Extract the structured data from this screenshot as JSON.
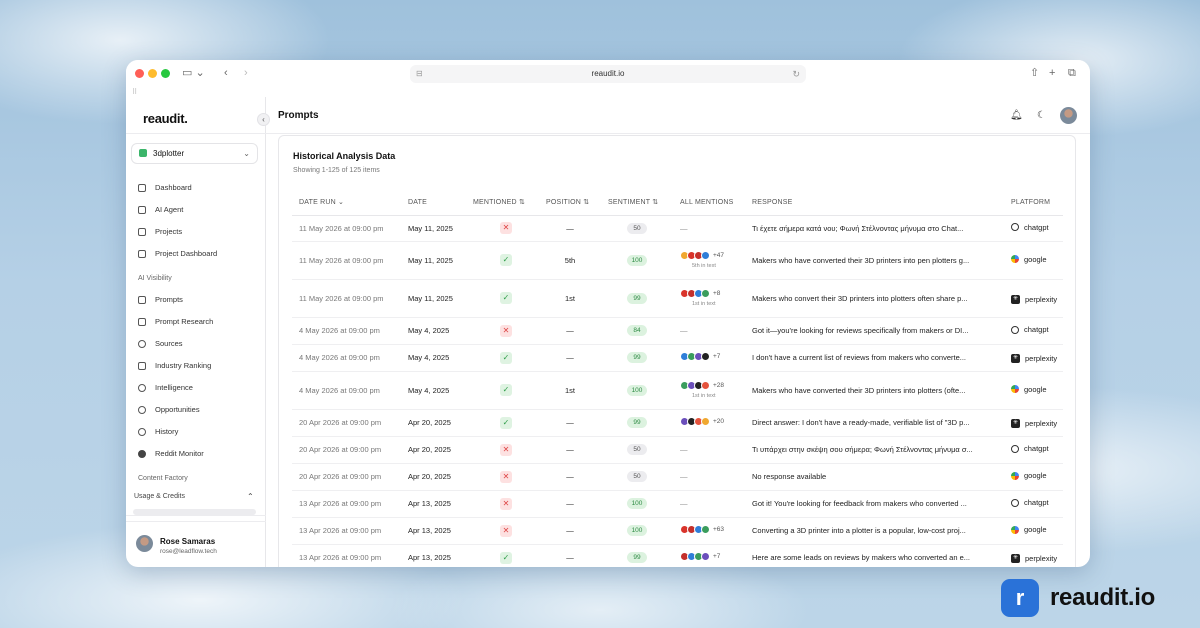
{
  "browser": {
    "url": "reaudit.io"
  },
  "sidebar": {
    "logo": "reaudit.",
    "project": "3dplotter",
    "items": [
      {
        "label": "Dashboard",
        "icon": "home-icon"
      },
      {
        "label": "AI Agent",
        "icon": "robot-icon"
      },
      {
        "label": "Projects",
        "icon": "folder-icon"
      },
      {
        "label": "Project Dashboard",
        "icon": "bar-chart-icon"
      }
    ],
    "section_ai": "AI Visibility",
    "ai_items": [
      {
        "label": "Prompts",
        "icon": "chat-icon"
      },
      {
        "label": "Prompt Research",
        "icon": "wand-icon"
      },
      {
        "label": "Sources",
        "icon": "link-icon"
      },
      {
        "label": "Industry Ranking",
        "icon": "trending-icon"
      },
      {
        "label": "Intelligence",
        "icon": "target-icon"
      },
      {
        "label": "Opportunities",
        "icon": "lightbulb-icon"
      },
      {
        "label": "History",
        "icon": "clock-icon"
      },
      {
        "label": "Reddit Monitor",
        "icon": "reddit-icon"
      }
    ],
    "section_content": "Content Factory",
    "usage_label": "Usage & Credits",
    "user": {
      "name": "Rose Samaras",
      "email": "rose@leadflow.tech"
    }
  },
  "header": {
    "title": "Prompts"
  },
  "card": {
    "title": "Historical Analysis Data",
    "subtitle": "Showing 1-125 of 125 items"
  },
  "table": {
    "headers": [
      "DATE RUN ⌄",
      "DATE",
      "MENTIONED ⇅",
      "POSITION ⇅",
      "SENTIMENT ⇅",
      "ALL MENTIONS",
      "RESPONSE",
      "PLATFORM"
    ],
    "rows": [
      {
        "run": "11 May 2026 at 09:00 pm",
        "date": "May 11, 2025",
        "mentioned": false,
        "position": "—",
        "sentiment": "50",
        "mentions": null,
        "mentions_sub": "",
        "response": "Τι έχετε σήμερα κατά νου; Φωνή Στέλνοντας μήνυμα στο Chat...",
        "platform": "chatgpt"
      },
      {
        "run": "11 May 2026 at 09:00 pm",
        "date": "May 11, 2025",
        "mentioned": true,
        "position": "5th",
        "sentiment": "100",
        "mentions": "+47",
        "mentions_sub": "5th in text",
        "response": "Makers who have converted their 3D printers into pen plotters g...",
        "platform": "google"
      },
      {
        "run": "11 May 2026 at 09:00 pm",
        "date": "May 11, 2025",
        "mentioned": true,
        "position": "1st",
        "sentiment": "99",
        "mentions": "+8",
        "mentions_sub": "1st in text",
        "response": "Makers who convert their 3D printers into plotters often share p...",
        "platform": "perplexity"
      },
      {
        "run": "4 May 2026 at 09:00 pm",
        "date": "May 4, 2025",
        "mentioned": false,
        "position": "—",
        "sentiment": "84",
        "mentions": null,
        "mentions_sub": "",
        "response": "Got it—you're looking for reviews specifically from makers or DI...",
        "platform": "chatgpt"
      },
      {
        "run": "4 May 2026 at 09:00 pm",
        "date": "May 4, 2025",
        "mentioned": true,
        "position": "—",
        "sentiment": "99",
        "mentions": "+7",
        "mentions_sub": "",
        "response": "I don't have a current list of reviews from makers who converte...",
        "platform": "perplexity"
      },
      {
        "run": "4 May 2026 at 09:00 pm",
        "date": "May 4, 2025",
        "mentioned": true,
        "position": "1st",
        "sentiment": "100",
        "mentions": "+28",
        "mentions_sub": "1st in text",
        "response": "Makers who have converted their 3D printers into plotters (ofte...",
        "platform": "google"
      },
      {
        "run": "20 Apr 2026 at 09:00 pm",
        "date": "Apr 20, 2025",
        "mentioned": true,
        "position": "—",
        "sentiment": "99",
        "mentions": "+20",
        "mentions_sub": "",
        "response": "Direct answer: I don't have a ready-made, verifiable list of \"3D p...",
        "platform": "perplexity"
      },
      {
        "run": "20 Apr 2026 at 09:00 pm",
        "date": "Apr 20, 2025",
        "mentioned": false,
        "position": "—",
        "sentiment": "50",
        "mentions": null,
        "mentions_sub": "",
        "response": "Τι υπάρχει στην σκέψη σου σήμερα; Φωνή Στέλνοντας μήνυμα σ...",
        "platform": "chatgpt"
      },
      {
        "run": "20 Apr 2026 at 09:00 pm",
        "date": "Apr 20, 2025",
        "mentioned": false,
        "position": "—",
        "sentiment": "50",
        "mentions": null,
        "mentions_sub": "",
        "response": "No response available",
        "platform": "google"
      },
      {
        "run": "13 Apr 2026 at 09:00 pm",
        "date": "Apr 13, 2025",
        "mentioned": false,
        "position": "—",
        "sentiment": "100",
        "mentions": null,
        "mentions_sub": "",
        "response": "Got it! You're looking for feedback from makers who converted ...",
        "platform": "chatgpt"
      },
      {
        "run": "13 Apr 2026 at 09:00 pm",
        "date": "Apr 13, 2025",
        "mentioned": false,
        "position": "—",
        "sentiment": "100",
        "mentions": "+63",
        "mentions_sub": "",
        "response": "Converting a 3D printer into a plotter is a popular, low-cost proj...",
        "platform": "google"
      },
      {
        "run": "13 Apr 2026 at 09:00 pm",
        "date": "Apr 13, 2025",
        "mentioned": true,
        "position": "—",
        "sentiment": "99",
        "mentions": "+7",
        "mentions_sub": "",
        "response": "Here are some leads on reviews by makers who converted an e...",
        "platform": "perplexity"
      }
    ]
  },
  "brand": {
    "logo_letter": "r",
    "name": "reaudit.io"
  },
  "colors": {
    "accent": "#2a72d8",
    "mention_yes": "#2e9d47",
    "mention_no": "#dd4444"
  }
}
